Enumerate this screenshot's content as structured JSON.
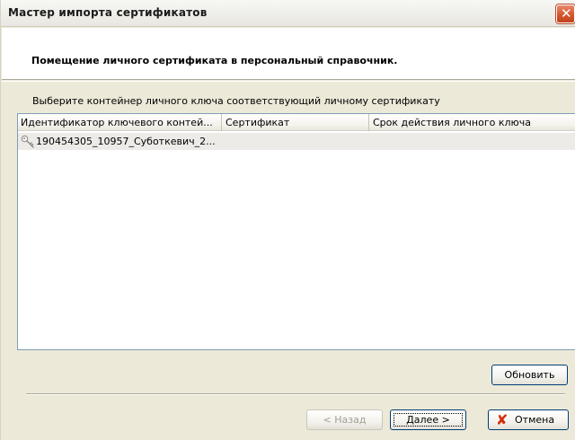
{
  "window": {
    "title": "Мастер импорта сертификатов",
    "close_glyph": "✕"
  },
  "header": {
    "title": "Помещение личного сертификата в персональный справочник."
  },
  "instruction": "Выберите контейнер личного ключа соответствующий личному сертификату",
  "list": {
    "columns": [
      "Идентификатор ключевого контей...",
      "Сертификат",
      "Срок действия личного ключа"
    ],
    "rows": [
      {
        "icon": "key-icon",
        "cells": [
          "190454305_10957_Суботкевич_2...",
          "",
          ""
        ]
      }
    ]
  },
  "buttons": {
    "refresh": "Обновить",
    "back": "< Назад",
    "next": "Далее >",
    "cancel": "Отмена",
    "cancel_icon": "✘"
  },
  "colors": {
    "window_bg": "#ece9d8",
    "close_button": "#d4562e",
    "cancel_icon": "#d62c0b",
    "selected_row": "#ecebe8"
  }
}
